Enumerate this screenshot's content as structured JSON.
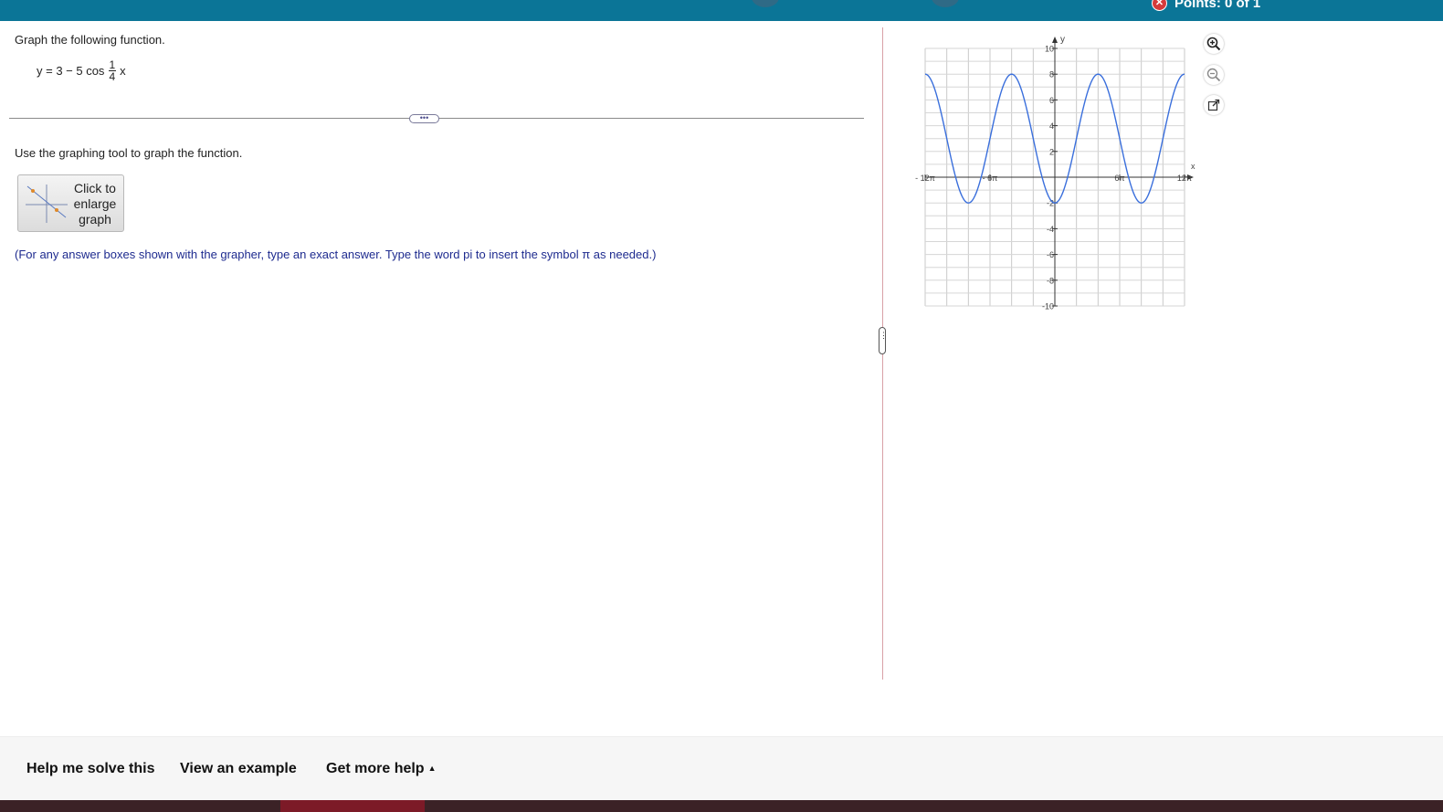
{
  "header": {
    "points_label": "Points: 0 of 1",
    "points_icon": "x-circle-icon",
    "bar_color": "#0b7597"
  },
  "question": {
    "instruction": "Graph the following function.",
    "equation_prefix": "y = 3 − 5 cos",
    "fraction_numerator": "1",
    "fraction_denominator": "4",
    "equation_suffix": "x",
    "divider_handle": "•••",
    "tool_instruction": "Use the graphing tool to graph the function.",
    "enlarge_button_label": "Click to enlarge graph",
    "note": "(For any answer boxes shown with the grapher, type an exact answer. Type the word pi to insert the symbol π as needed.)"
  },
  "graph": {
    "x_axis_label": "x",
    "y_axis_label": "y",
    "x_tick_labels": [
      "- 12π",
      "- 6π",
      "6π",
      "12π"
    ],
    "y_tick_labels": [
      "10",
      "8",
      "6",
      "4",
      "2",
      "-2",
      "-4",
      "-6",
      "-8",
      "-10"
    ],
    "curve_color": "#3a6fdc",
    "function": {
      "a": 3,
      "b": -5,
      "k": 0.25
    },
    "x_range": [
      "-12π",
      "12π"
    ],
    "y_range": [
      -10,
      10
    ],
    "zoom_in_icon": "zoom-in-icon",
    "zoom_out_icon": "zoom-out-icon",
    "popout_icon": "external-link-icon"
  },
  "split_handle": "⋮",
  "footer": {
    "help_me_solve": "Help me solve this",
    "view_example": "View an example",
    "get_more_help": "Get more help",
    "get_more_help_caret": "▲"
  }
}
